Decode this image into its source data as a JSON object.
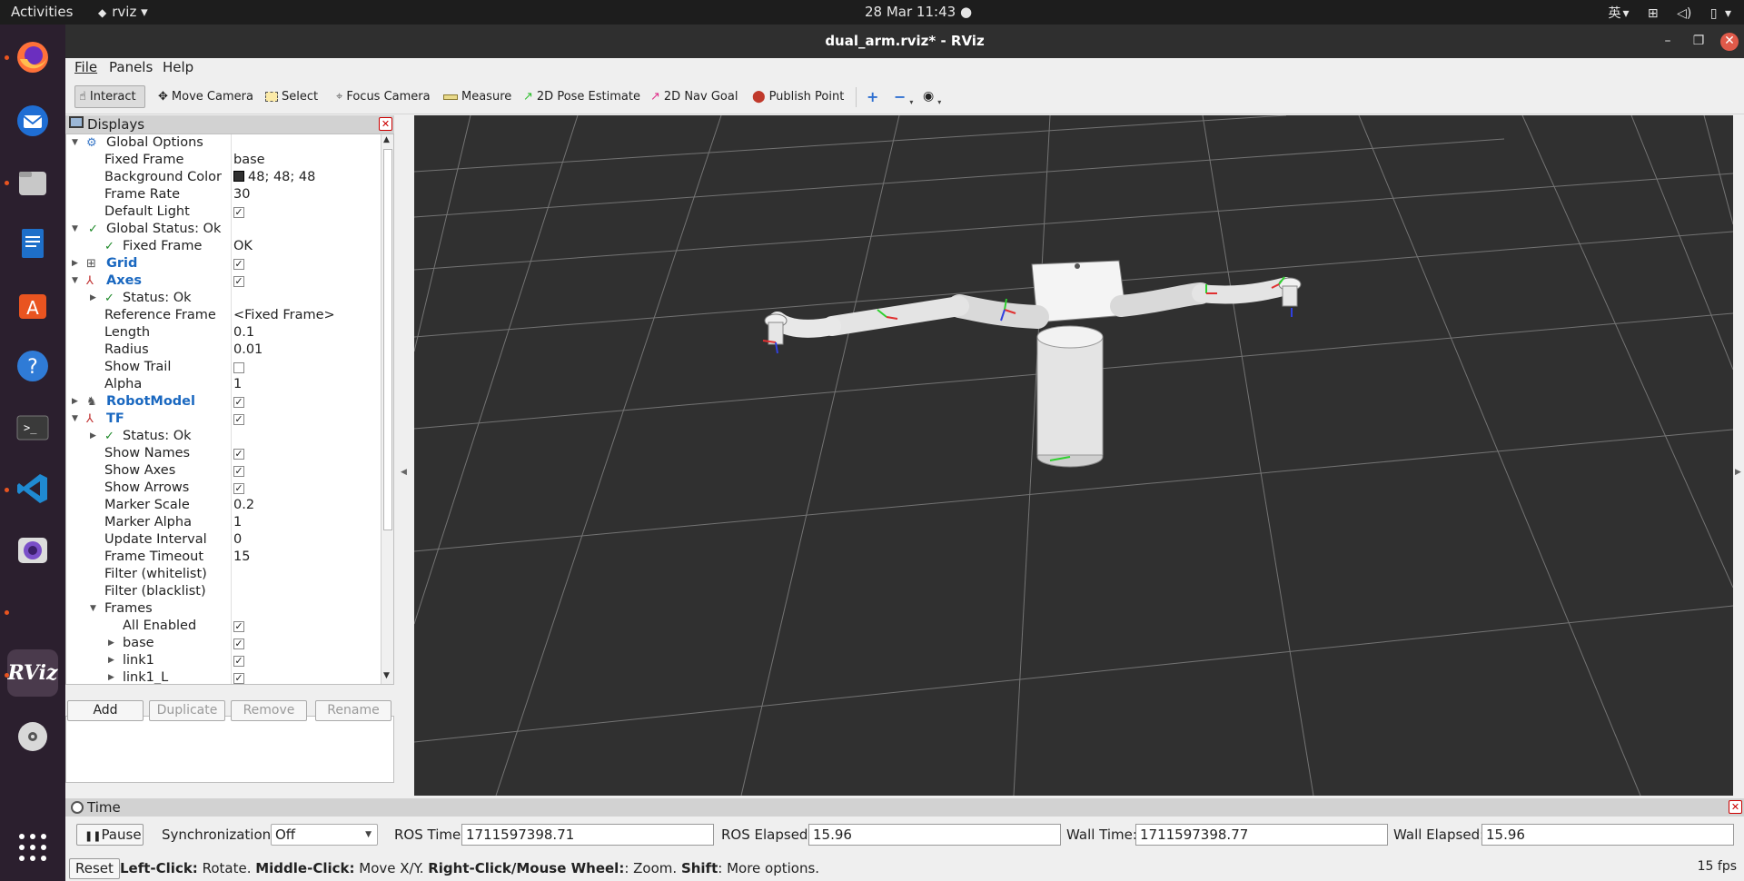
{
  "topbar": {
    "activities": "Activities",
    "app_name": "rviz",
    "datetime": "28 Mar  11:43",
    "ime": "英"
  },
  "dock": {
    "items": [
      "firefox-icon",
      "thunderbird-icon",
      "files-icon",
      "writer-icon",
      "software-icon",
      "help-icon",
      "terminal-icon",
      "vscode-icon",
      "camera-icon",
      "rviz-icon",
      "disc-icon",
      "apps-grid-icon"
    ],
    "rviz_label": "RViz"
  },
  "window": {
    "title": "dual_arm.rviz* - RViz"
  },
  "menu": {
    "file": "File",
    "panels": "Panels",
    "help": "Help"
  },
  "toolbar": {
    "interact": "Interact",
    "move_camera": "Move Camera",
    "select": "Select",
    "focus_camera": "Focus Camera",
    "measure": "Measure",
    "pose_estimate": "2D Pose Estimate",
    "nav_goal": "2D Nav Goal",
    "publish_point": "Publish Point"
  },
  "displays": {
    "title": "Displays",
    "rows": {
      "global_options": "Global Options",
      "fixed_frame_lbl": "Fixed Frame",
      "fixed_frame_val": "base",
      "bg_color_lbl": "Background Color",
      "bg_color_val": "48; 48; 48",
      "frame_rate_lbl": "Frame Rate",
      "frame_rate_val": "30",
      "default_light_lbl": "Default Light",
      "global_status": "Global Status: Ok",
      "status_fixed_frame_lbl": "Fixed Frame",
      "status_fixed_frame_val": "OK",
      "grid": "Grid",
      "axes": "Axes",
      "axes_status": "Status: Ok",
      "ref_frame_lbl": "Reference Frame",
      "ref_frame_val": "<Fixed Frame>",
      "length_lbl": "Length",
      "length_val": "0.1",
      "radius_lbl": "Radius",
      "radius_val": "0.01",
      "show_trail_lbl": "Show Trail",
      "alpha_lbl": "Alpha",
      "alpha_val": "1",
      "robot_model": "RobotModel",
      "tf": "TF",
      "tf_status": "Status: Ok",
      "show_names_lbl": "Show Names",
      "show_axes_lbl": "Show Axes",
      "show_arrows_lbl": "Show Arrows",
      "marker_scale_lbl": "Marker Scale",
      "marker_scale_val": "0.2",
      "marker_alpha_lbl": "Marker Alpha",
      "marker_alpha_val": "1",
      "update_interval_lbl": "Update Interval",
      "update_interval_val": "0",
      "frame_timeout_lbl": "Frame Timeout",
      "frame_timeout_val": "15",
      "filter_white_lbl": "Filter (whitelist)",
      "filter_black_lbl": "Filter (blacklist)",
      "frames_lbl": "Frames",
      "all_enabled_lbl": "All Enabled",
      "base_lbl": "base",
      "link1_lbl": "link1",
      "link1L_lbl": "link1_L"
    },
    "buttons": {
      "add": "Add",
      "duplicate": "Duplicate",
      "remove": "Remove",
      "rename": "Rename"
    }
  },
  "time": {
    "title": "Time",
    "pause": "Pause",
    "sync_label": "Synchronization:",
    "sync_value": "Off",
    "ros_time_label": "ROS Time:",
    "ros_time": "1711597398.71",
    "ros_elapsed_label": "ROS Elapsed:",
    "ros_elapsed": "15.96",
    "wall_time_label": "Wall Time:",
    "wall_time": "1711597398.77",
    "wall_elapsed_label": "Wall Elapsed:",
    "wall_elapsed": "15.96"
  },
  "status": {
    "reset": "Reset",
    "left_click": "Left-Click:",
    "left_desc": " Rotate. ",
    "middle_click": "Middle-Click:",
    "middle_desc": " Move X/Y. ",
    "right_click": "Right-Click/Mouse Wheel:",
    "right_desc": ": Zoom. ",
    "shift": "Shift",
    "shift_desc": ": More options.",
    "fps": "15 fps"
  }
}
